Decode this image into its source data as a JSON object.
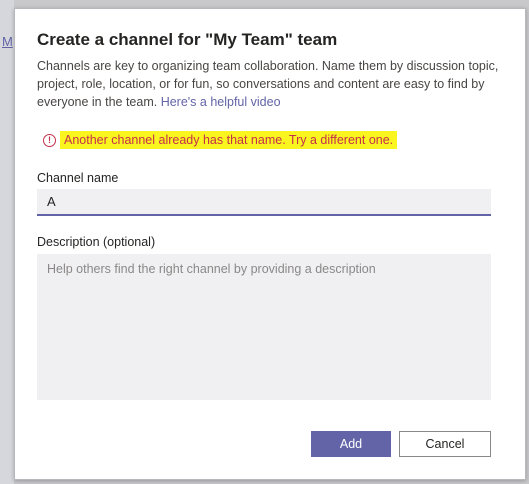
{
  "background": {
    "link_text": "M"
  },
  "dialog": {
    "title": "Create a channel for \"My Team\" team",
    "description": "Channels are key to organizing team collaboration. Name them by discussion topic, project, role, location, or for fun, so conversations and content are easy to find by everyone in the team.",
    "help_link": "Here's a helpful video",
    "error": {
      "icon": "error-circle-icon",
      "icon_glyph": "!",
      "message": "Another channel already has that name. Try a different one.",
      "highlight_color": "#fbf51f",
      "text_color": "#c4314b"
    },
    "channel_name": {
      "label": "Channel name",
      "value": "A"
    },
    "description_field": {
      "label": "Description (optional)",
      "placeholder": "Help others find the right channel by providing a description",
      "value": ""
    },
    "buttons": {
      "add_label": "Add",
      "cancel_label": "Cancel"
    },
    "colors": {
      "accent": "#6264a7",
      "input_bg": "#f0f0f3"
    }
  }
}
